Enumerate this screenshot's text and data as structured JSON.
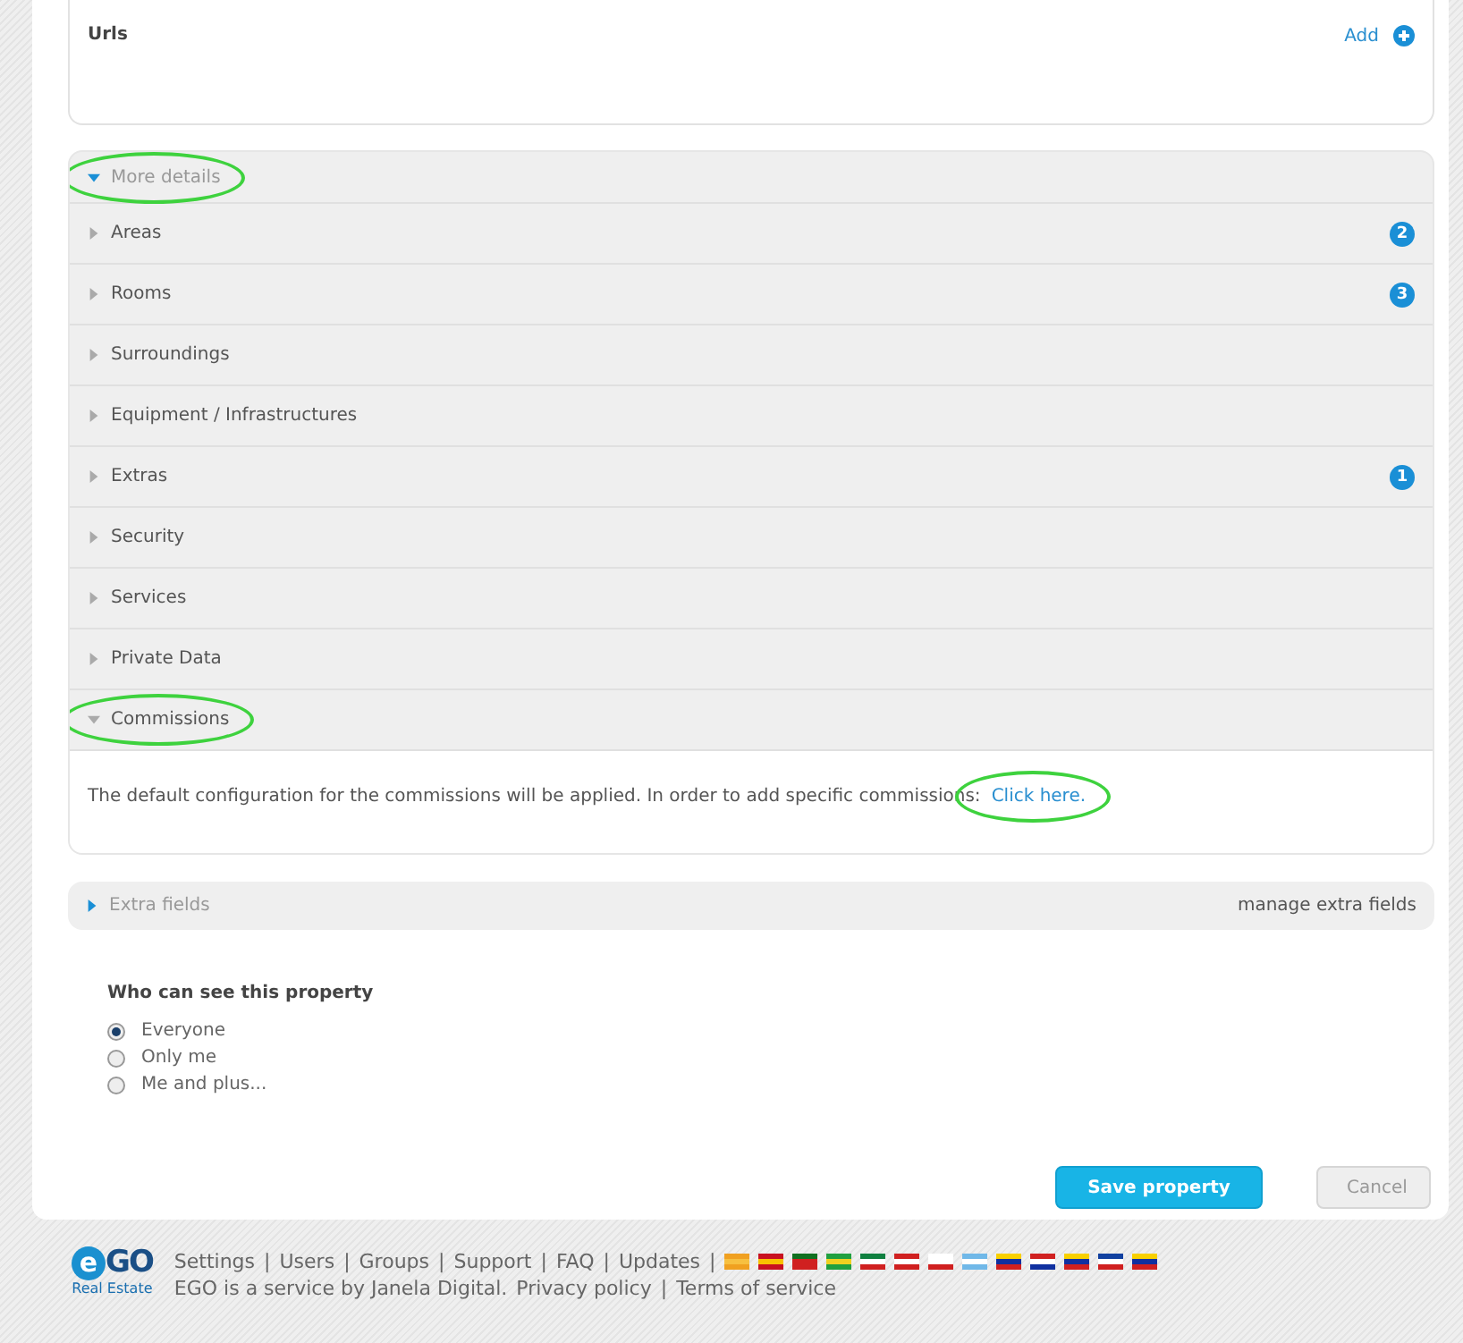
{
  "urls": {
    "title": "Urls",
    "add_label": "Add"
  },
  "more_details": {
    "label": "More details",
    "expanded": true,
    "highlighted": true,
    "sections": [
      {
        "label": "Areas",
        "expanded": false,
        "badge": "2"
      },
      {
        "label": "Rooms",
        "expanded": false,
        "badge": "3"
      },
      {
        "label": "Surroundings",
        "expanded": false
      },
      {
        "label": "Equipment / Infrastructures",
        "expanded": false
      },
      {
        "label": "Extras",
        "expanded": false,
        "badge": "1"
      },
      {
        "label": "Security",
        "expanded": false
      },
      {
        "label": "Services",
        "expanded": false
      },
      {
        "label": "Private Data",
        "expanded": false
      },
      {
        "label": "Commissions",
        "expanded": true,
        "highlighted": true,
        "text": "The default configuration for the commissions will be applied. In order to add specific commissions:",
        "link": "Click here.",
        "link_highlighted": true
      }
    ]
  },
  "extra_fields": {
    "label": "Extra fields",
    "expanded": false,
    "manage": "manage extra fields"
  },
  "visibility": {
    "title": "Who can see this property",
    "options": [
      {
        "label": "Everyone",
        "selected": true
      },
      {
        "label": "Only me",
        "selected": false
      },
      {
        "label": "Me and plus...",
        "selected": false
      }
    ]
  },
  "buttons": [
    {
      "label": "Save property",
      "kind": "primary"
    },
    {
      "label": "Cancel",
      "kind": "secondary"
    }
  ],
  "footer": {
    "logo_mark": "e",
    "logo_name": "GO",
    "logo_tagline": "Real Estate",
    "links": [
      "Settings",
      "Users",
      "Groups",
      "Support",
      "FAQ",
      "Updates"
    ],
    "service_text": "EGO is a service by Janela Digital.",
    "legal_links": [
      "Privacy policy",
      "Terms of service"
    ],
    "separator": "|"
  }
}
